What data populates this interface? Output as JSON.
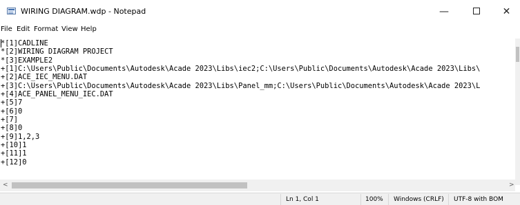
{
  "window": {
    "title": "WIRING DIAGRAM.wdp - Notepad",
    "controls": {
      "minimize": "—",
      "close": "✕"
    }
  },
  "menu": {
    "items": [
      "File",
      "Edit",
      "Format",
      "View",
      "Help"
    ]
  },
  "editor": {
    "lines": [
      "*[1]CADLINE",
      "*[2]WIRING DIAGRAM PROJECT",
      "*[3]EXAMPLE2",
      "+[1]C:\\Users\\Public\\Documents\\Autodesk\\Acade 2023\\Libs\\iec2;C:\\Users\\Public\\Documents\\Autodesk\\Acade 2023\\Libs\\",
      "+[2]ACE_IEC_MENU.DAT",
      "+[3]C:\\Users\\Public\\Documents\\Autodesk\\Acade 2023\\Libs\\Panel_mm;C:\\Users\\Public\\Documents\\Autodesk\\Acade 2023\\L",
      "+[4]ACE_PANEL_MENU_IEC.DAT",
      "+[5]7",
      "+[6]0",
      "+[7]",
      "+[8]0",
      "+[9]1,2,3",
      "+[10]1",
      "+[11]1",
      "+[12]0"
    ]
  },
  "scrollbar": {
    "left_arrow": "<",
    "right_arrow": ">"
  },
  "statusbar": {
    "position": "Ln 1, Col 1",
    "zoom": "100%",
    "line_ending": "Windows (CRLF)",
    "encoding": "UTF-8 with BOM"
  }
}
